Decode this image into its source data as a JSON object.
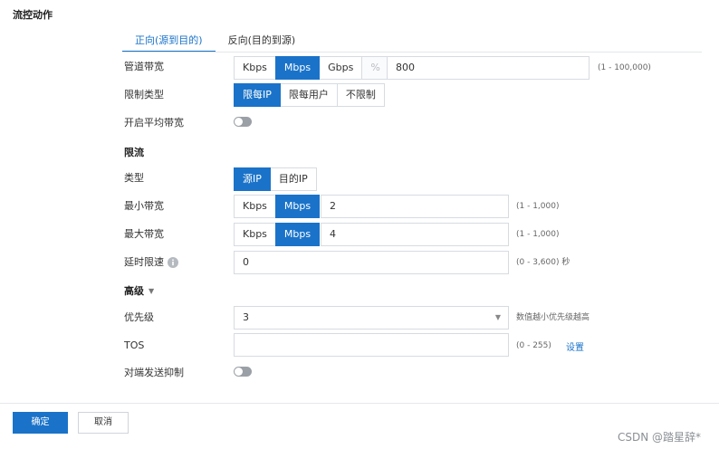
{
  "section_title": "流控动作",
  "tabs": [
    {
      "label": "正向(源到目的)",
      "active": true
    },
    {
      "label": "反向(目的到源)",
      "active": false
    }
  ],
  "pipe_bandwidth": {
    "label": "管道带宽",
    "units": [
      "Kbps",
      "Mbps",
      "Gbps",
      "%"
    ],
    "selected_unit": "Mbps",
    "value": "800",
    "hint": "(1 - 100,000)"
  },
  "limit_type": {
    "label": "限制类型",
    "options": [
      "限每IP",
      "限每用户",
      "不限制"
    ],
    "selected": "限每IP"
  },
  "avg_bandwidth": {
    "label": "开启平均带宽",
    "on": false
  },
  "rate_limit_title": "限流",
  "type": {
    "label": "类型",
    "options": [
      "源IP",
      "目的IP"
    ],
    "selected": "源IP"
  },
  "min_bandwidth": {
    "label": "最小带宽",
    "units": [
      "Kbps",
      "Mbps"
    ],
    "selected_unit": "Mbps",
    "value": "2",
    "hint": "(1 - 1,000)"
  },
  "max_bandwidth": {
    "label": "最大带宽",
    "units": [
      "Kbps",
      "Mbps"
    ],
    "selected_unit": "Mbps",
    "value": "4",
    "hint": "(1 - 1,000)"
  },
  "delay_limit": {
    "label": "延时限速",
    "info_icon": "info-icon",
    "value": "0",
    "hint": "(0 - 3,600) 秒"
  },
  "advanced_title": "高级",
  "priority": {
    "label": "优先级",
    "value": "3",
    "hint": "数值越小优先级越高"
  },
  "tos": {
    "label": "TOS",
    "value": "",
    "hint": "(0 - 255)",
    "link": "设置"
  },
  "suppress": {
    "label": "对端发送抑制",
    "on": false
  },
  "footer": {
    "ok": "确定",
    "cancel": "取消"
  },
  "watermark": "CSDN @踏星辞*",
  "colors": {
    "accent": "#1a73c9",
    "border": "#d7dbe0",
    "toggle_off": "#9aa0a6"
  }
}
